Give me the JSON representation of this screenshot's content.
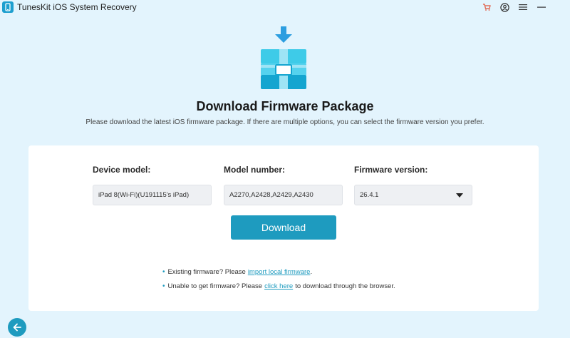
{
  "window": {
    "title": "TunesKit iOS System Recovery",
    "icons": [
      "cart-icon",
      "user-icon",
      "menu-icon",
      "minimize-icon"
    ]
  },
  "header": {
    "title": "Download Firmware Package",
    "subtitle": "Please download the latest iOS firmware package. If there are multiple options, you can select the firmware version you prefer."
  },
  "form": {
    "device_model_label": "Device model:",
    "device_model_value": "iPad 8(Wi-Fi)(U191115's iPad)",
    "model_number_label": "Model number:",
    "model_number_value": "A2270,A2428,A2429,A2430",
    "firmware_version_label": "Firmware version:",
    "firmware_version_value": "26.4.1"
  },
  "actions": {
    "download_label": "Download"
  },
  "hints": {
    "existing_prefix": "Existing firmware? Please",
    "existing_link": "import local firmware",
    "existing_suffix": ".",
    "unable_prefix": "Unable to get firmware? Please",
    "unable_link": "click here",
    "unable_suffix": "to download through the browser."
  },
  "colors": {
    "background": "#e3f4fd",
    "accent": "#1e9bbf",
    "card": "#ffffff"
  }
}
